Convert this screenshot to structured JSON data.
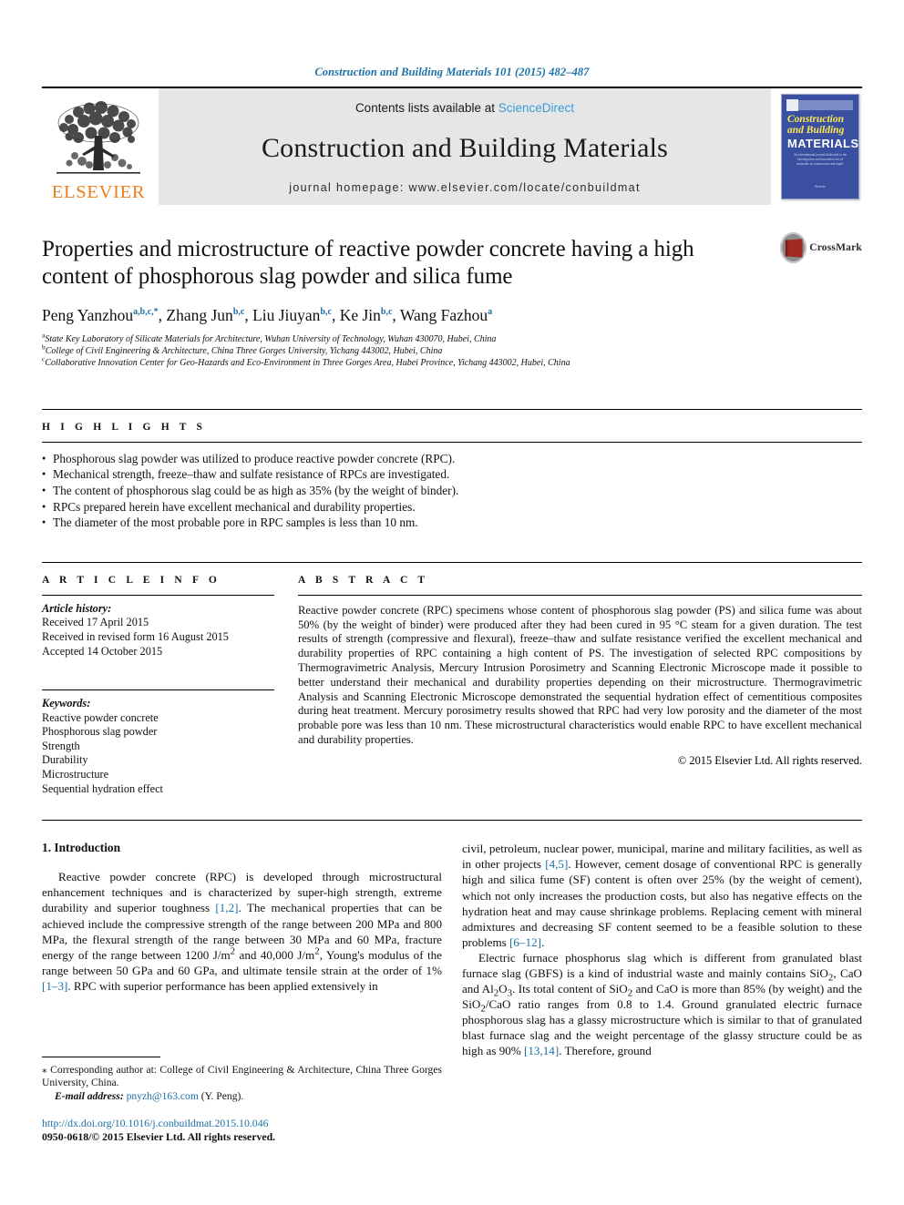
{
  "running_head": "Construction and Building Materials 101 (2015) 482–487",
  "masthead": {
    "contents_prefix": "Contents lists available at ",
    "sciencedirect": "ScienceDirect",
    "journal_title": "Construction and Building Materials",
    "homepage": "journal homepage: www.elsevier.com/locate/conbuildmat",
    "publisher_logo_text": "ELSEVIER",
    "cover": {
      "line1": "Construction",
      "line2": "and Building",
      "line3": "MATERIALS",
      "subtitle": "An international journal dedicated to the investigation and innovative use of materials in construction and repair",
      "footer": "Elsevier"
    }
  },
  "article": {
    "title": "Properties and microstructure of reactive powder concrete having a high content of phosphorous slag powder and silica fume",
    "crossmark_label": "CrossMark",
    "authors": [
      {
        "name": "Peng Yanzhou",
        "marks": "a,b,c,*"
      },
      {
        "name": "Zhang Jun",
        "marks": "b,c"
      },
      {
        "name": "Liu Jiuyan",
        "marks": "b,c"
      },
      {
        "name": "Ke Jin",
        "marks": "b,c"
      },
      {
        "name": "Wang Fazhou",
        "marks": "a"
      }
    ],
    "affiliations": [
      {
        "mark": "a",
        "text": "State Key Laboratory of Silicate Materials for Architecture, Wuhan University of Technology, Wuhan 430070, Hubei, China"
      },
      {
        "mark": "b",
        "text": "College of Civil Engineering & Architecture, China Three Gorges University, Yichang 443002, Hubei, China"
      },
      {
        "mark": "c",
        "text": "Collaborative Innovation Center for Geo-Hazards and Eco-Environment in Three Gorges Area, Hubei Province, Yichang 443002, Hubei, China"
      }
    ]
  },
  "highlights": {
    "label": "H I G H L I G H T S",
    "items": [
      "Phosphorous slag powder was utilized to produce reactive powder concrete (RPC).",
      "Mechanical strength, freeze–thaw and sulfate resistance of RPCs are investigated.",
      "The content of phosphorous slag could be as high as 35% (by the weight of binder).",
      "RPCs prepared herein have excellent mechanical and durability properties.",
      "The diameter of the most probable pore in RPC samples is less than 10 nm."
    ]
  },
  "article_info": {
    "label": "A R T I C L E   I N F O",
    "history_label": "Article history:",
    "history": [
      "Received 17 April 2015",
      "Received in revised form 16 August 2015",
      "Accepted 14 October 2015"
    ],
    "keywords_label": "Keywords:",
    "keywords": [
      "Reactive powder concrete",
      "Phosphorous slag powder",
      "Strength",
      "Durability",
      "Microstructure",
      "Sequential hydration effect"
    ]
  },
  "abstract": {
    "label": "A B S T R A C T",
    "text": "Reactive powder concrete (RPC) specimens whose content of phosphorous slag powder (PS) and silica fume was about 50% (by the weight of binder) were produced after they had been cured in 95 °C steam for a given duration. The test results of strength (compressive and flexural), freeze–thaw and sulfate resistance verified the excellent mechanical and durability properties of RPC containing a high content of PS. The investigation of selected RPC compositions by Thermogravimetric Analysis, Mercury Intrusion Porosimetry and Scanning Electronic Microscope made it possible to better understand their mechanical and durability properties depending on their microstructure. Thermogravimetric Analysis and Scanning Electronic Microscope demonstrated the sequential hydration effect of cementitious composites during heat treatment. Mercury porosimetry results showed that RPC had very low porosity and the diameter of the most probable pore was less than 10 nm. These microstructural characteristics would enable RPC to have excellent mechanical and durability properties.",
    "copyright": "© 2015 Elsevier Ltd. All rights reserved."
  },
  "body": {
    "section_heading": "1. Introduction",
    "left_para_1_a": "Reactive powder concrete (RPC) is developed through microstructural enhancement techniques and is characterized by super-high strength, extreme durability and superior toughness ",
    "left_ref_1": "[1,2]",
    "left_para_1_b": ". The mechanical properties that can be achieved include the compressive strength of the range between 200 MPa and 800 MPa, the flexural strength of the range between 30 MPa and 60 MPa, fracture energy of the range between 1200 J/m",
    "left_para_1_c": " and 40,000 J/m",
    "left_para_1_d": ", Young's modulus of the range between 50 GPa and 60 GPa, and ultimate tensile strain at the order of 1% ",
    "left_ref_2": "[1–3]",
    "left_para_1_e": ". RPC with superior performance has been applied extensively in",
    "right_para_1_a": "civil, petroleum, nuclear power, municipal, marine and military facilities, as well as in other projects ",
    "right_ref_1": "[4,5]",
    "right_para_1_b": ". However, cement dosage of conventional RPC is generally high and silica fume (SF) content is often over 25% (by the weight of cement), which not only increases the production costs, but also has negative effects on the hydration heat and may cause shrinkage problems. Replacing cement with mineral admixtures and decreasing SF content seemed to be a feasible solution to these problems ",
    "right_ref_2": "[6–12]",
    "right_para_1_c": ".",
    "right_para_2_a": "Electric furnace phosphorus slag which is different from granulated blast furnace slag (GBFS) is a kind of industrial waste and mainly contains SiO",
    "right_para_2_b": ", CaO and Al",
    "right_para_2_c": "O",
    "right_para_2_d": ". Its total content of SiO",
    "right_para_2_e": " and CaO is more than 85% (by weight) and the SiO",
    "right_para_2_f": "/CaO ratio ranges from 0.8 to 1.4. Ground granulated electric furnace phosphorous slag has a glassy microstructure which is similar to that of granulated blast furnace slag and the weight percentage of the glassy structure could be as high as 90% ",
    "right_ref_3": "[13,14]",
    "right_para_2_g": ". Therefore, ground"
  },
  "footnote": {
    "corresponding": "⁎ Corresponding author at: College of Civil Engineering & Architecture, China Three Gorges University, China.",
    "email_label": "E-mail address:",
    "email": "pnyzh@163.com",
    "email_suffix": "(Y. Peng).",
    "doi": "http://dx.doi.org/10.1016/j.conbuildmat.2015.10.046",
    "issn": "0950-0618/© 2015 Elsevier Ltd. All rights reserved."
  },
  "colors": {
    "link_blue": "#1b70a8",
    "sciencedirect_blue": "#3a9bd9",
    "elsevier_orange": "#ef7d1a",
    "cover_blue": "#3b4fa0"
  }
}
